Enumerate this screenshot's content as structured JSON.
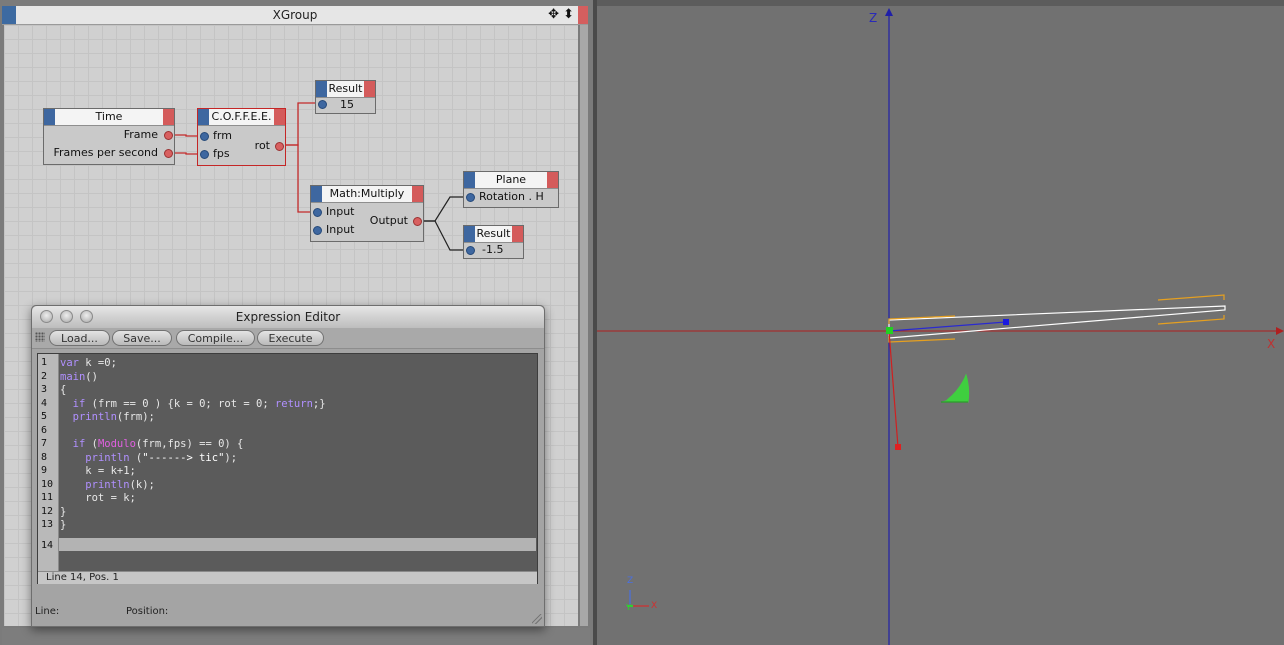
{
  "xpresso": {
    "title": "XGroup",
    "tool_icons": "✥ ⬍",
    "nodes": {
      "time": {
        "title": "Time",
        "ports": [
          "Frame",
          "Frames per second"
        ]
      },
      "coffee": {
        "title": "C.O.F.F.E.E.",
        "inputs": [
          "frm",
          "fps"
        ],
        "output": "rot"
      },
      "result1": {
        "title": "Result",
        "value": "15"
      },
      "multiply": {
        "title": "Math:Multiply",
        "inputs": [
          "Input",
          "Input"
        ],
        "output": "Output"
      },
      "plane": {
        "title": "Plane",
        "input": "Rotation . H"
      },
      "result2": {
        "title": "Result",
        "value": "-1.5"
      }
    }
  },
  "expression_editor": {
    "title": "Expression Editor",
    "buttons": [
      "Load...",
      "Save...",
      "Compile...",
      "Execute"
    ],
    "line_numbers": [
      "1",
      "2",
      "3",
      "4",
      "5",
      "6",
      "7",
      "8",
      "9",
      "10",
      "11",
      "12",
      "13",
      "14"
    ],
    "code": [
      "var k =0;",
      "main()",
      "{",
      "  if (frm == 0 ) {k = 0; rot = 0; return;}",
      "  println(frm);",
      "",
      "  if (Modulo(frm,fps) == 0) {",
      "    println (\"------> tic\");",
      "    k = k+1;",
      "    println(k);",
      "    rot = k;",
      "}",
      "}",
      ""
    ],
    "status": "Line 14, Pos. 1",
    "footer_line_label": "Line:",
    "footer_position_label": "Position:"
  },
  "viewport": {
    "axis_z": "Z",
    "axis_x": "X",
    "gizmo_z": "Z",
    "gizmo_x": "X",
    "gizmo_y": "Y"
  }
}
